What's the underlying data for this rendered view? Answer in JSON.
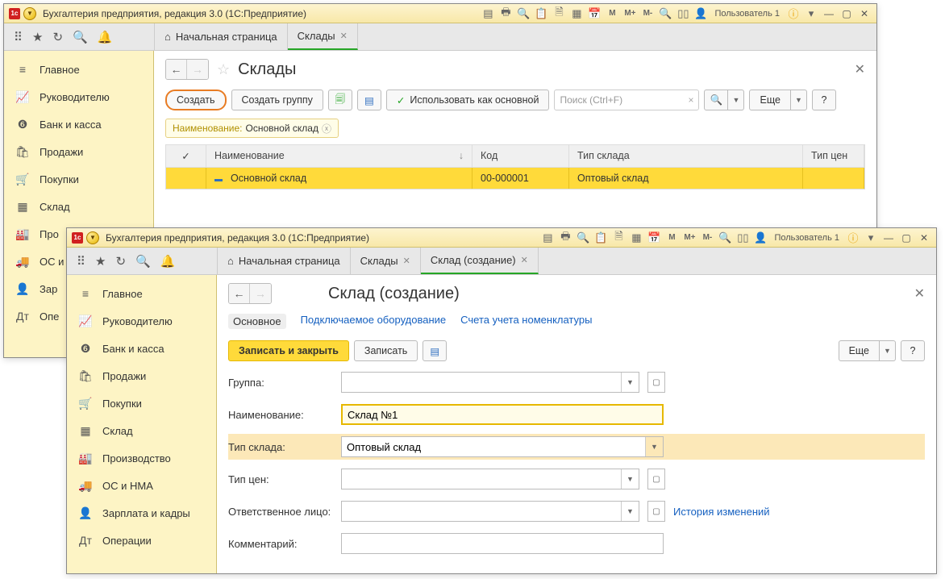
{
  "app_title": "Бухгалтерия предприятия, редакция 3.0  (1С:Предприятие)",
  "user_label": "Пользователь 1",
  "sidebar": [
    {
      "icon": "≡",
      "label": "Главное"
    },
    {
      "icon": "📈",
      "label": "Руководителю"
    },
    {
      "icon": "❻",
      "label": "Банк и касса"
    },
    {
      "icon": "🛍",
      "label": "Продажи"
    },
    {
      "icon": "🛒",
      "label": "Покупки"
    },
    {
      "icon": "▦",
      "label": "Склад"
    },
    {
      "icon": "🏭",
      "label": "Производство"
    },
    {
      "icon": "🚚",
      "label": "ОС и НМА"
    },
    {
      "icon": "👤",
      "label": "Зарплата и кадры"
    },
    {
      "icon": "Дт",
      "label": "Операции"
    }
  ],
  "sidebar_w1_trunc": [
    {
      "icon": "≡",
      "label": "Главное"
    },
    {
      "icon": "📈",
      "label": "Руководителю"
    },
    {
      "icon": "❻",
      "label": "Банк и касса"
    },
    {
      "icon": "🛍",
      "label": "Продажи"
    },
    {
      "icon": "🛒",
      "label": "Покупки"
    },
    {
      "icon": "▦",
      "label": "Склад"
    },
    {
      "icon": "🏭",
      "label": "Про"
    },
    {
      "icon": "🚚",
      "label": "ОС и"
    },
    {
      "icon": "👤",
      "label": "Зар"
    },
    {
      "icon": "Дт",
      "label": "Опе"
    }
  ],
  "w1": {
    "tabs": {
      "home": "Начальная страница",
      "t1": "Склады"
    },
    "page_title": "Склады",
    "toolbar": {
      "create": "Создать",
      "create_group": "Создать группу",
      "use_default": "Использовать как основной",
      "search_ph": "Поиск (Ctrl+F)",
      "more": "Еще"
    },
    "filter": {
      "label": "Наименование:",
      "value": "Основной склад"
    },
    "table": {
      "h_check": "✓",
      "h_name": "Наименование",
      "h_code": "Код",
      "h_type": "Тип склада",
      "h_price": "Тип цен",
      "r0": {
        "name": "Основной склад",
        "code": "00-000001",
        "type": "Оптовый склад"
      }
    }
  },
  "w2": {
    "tabs": {
      "home": "Начальная страница",
      "t1": "Склады",
      "t2": "Склад (создание)"
    },
    "page_title": "Склад (создание)",
    "subtabs": {
      "main": "Основное",
      "equip": "Подключаемое оборудование",
      "acct": "Счета учета номенклатуры"
    },
    "toolbar": {
      "save_close": "Записать и закрыть",
      "save": "Записать",
      "more": "Еще"
    },
    "form": {
      "group_label": "Группа:",
      "name_label": "Наименование:",
      "name_value": "Склад №1",
      "type_label": "Тип склада:",
      "type_value": "Оптовый склад",
      "pricetype_label": "Тип цен:",
      "responsible_label": "Ответственное лицо:",
      "history_link": "История изменений",
      "comment_label": "Комментарий:"
    }
  }
}
